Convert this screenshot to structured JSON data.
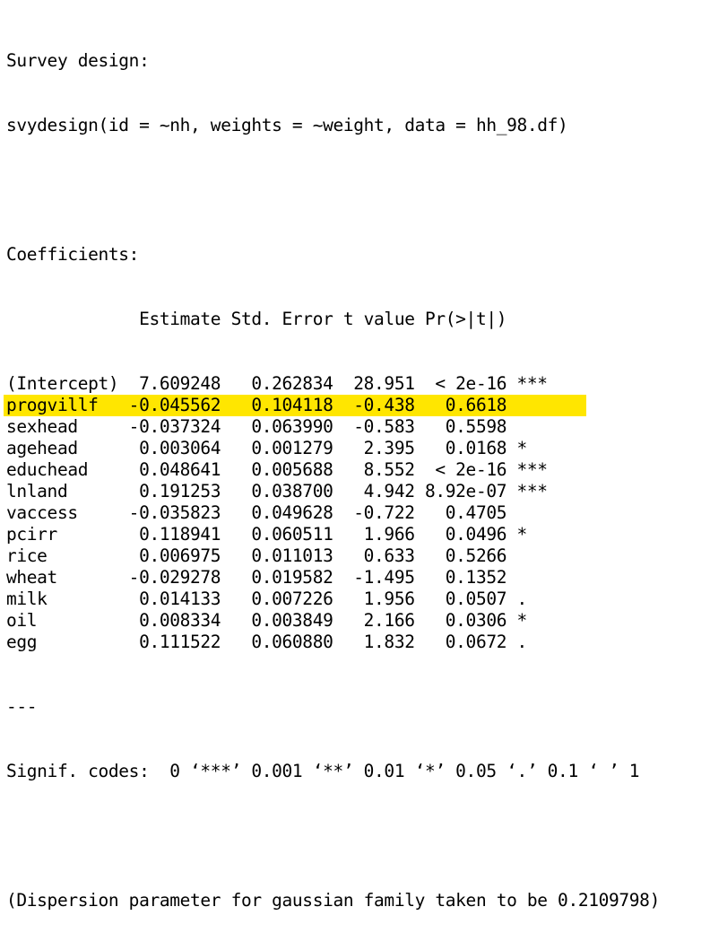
{
  "survey_header": "Survey design:",
  "call": "svydesign(id = ~nh, weights = ~weight, data = hh_98.df)",
  "coef_header": "Coefficients:",
  "columns": [
    "Estimate",
    "Std. Error",
    "t value",
    "Pr(>|t|)"
  ],
  "highlight_color": "#ffe600",
  "rows": [
    {
      "name": "(Intercept)",
      "estimate": "7.609248",
      "se": "0.262834",
      "t": "28.951",
      "p": "< 2e-16",
      "sig": "***",
      "highlight": false
    },
    {
      "name": "progvillf",
      "estimate": "-0.045562",
      "se": "0.104118",
      "t": "-0.438",
      "p": "0.6618",
      "sig": "",
      "highlight": true
    },
    {
      "name": "sexhead",
      "estimate": "-0.037324",
      "se": "0.063990",
      "t": "-0.583",
      "p": "0.5598",
      "sig": "",
      "highlight": false
    },
    {
      "name": "agehead",
      "estimate": "0.003064",
      "se": "0.001279",
      "t": "2.395",
      "p": "0.0168",
      "sig": "*",
      "highlight": false
    },
    {
      "name": "educhead",
      "estimate": "0.048641",
      "se": "0.005688",
      "t": "8.552",
      "p": "< 2e-16",
      "sig": "***",
      "highlight": false
    },
    {
      "name": "lnland",
      "estimate": "0.191253",
      "se": "0.038700",
      "t": "4.942",
      "p": "8.92e-07",
      "sig": "***",
      "highlight": false
    },
    {
      "name": "vaccess",
      "estimate": "-0.035823",
      "se": "0.049628",
      "t": "-0.722",
      "p": "0.4705",
      "sig": "",
      "highlight": false
    },
    {
      "name": "pcirr",
      "estimate": "0.118941",
      "se": "0.060511",
      "t": "1.966",
      "p": "0.0496",
      "sig": "*",
      "highlight": false
    },
    {
      "name": "rice",
      "estimate": "0.006975",
      "se": "0.011013",
      "t": "0.633",
      "p": "0.5266",
      "sig": "",
      "highlight": false
    },
    {
      "name": "wheat",
      "estimate": "-0.029278",
      "se": "0.019582",
      "t": "-1.495",
      "p": "0.1352",
      "sig": "",
      "highlight": false
    },
    {
      "name": "milk",
      "estimate": "0.014133",
      "se": "0.007226",
      "t": "1.956",
      "p": "0.0507",
      "sig": ".",
      "highlight": false
    },
    {
      "name": "oil",
      "estimate": "0.008334",
      "se": "0.003849",
      "t": "2.166",
      "p": "0.0306",
      "sig": "*",
      "highlight": false
    },
    {
      "name": "egg",
      "estimate": "0.111522",
      "se": "0.060880",
      "t": "1.832",
      "p": "0.0672",
      "sig": ".",
      "highlight": false
    }
  ],
  "separator": "---",
  "signif_codes": "Signif. codes:  0 ‘***’ 0.001 ‘**’ 0.01 ‘*’ 0.05 ‘.’ 0.1 ‘ ’ 1",
  "dispersion": "(Dispersion parameter for gaussian family taken to be 0.2109798)"
}
